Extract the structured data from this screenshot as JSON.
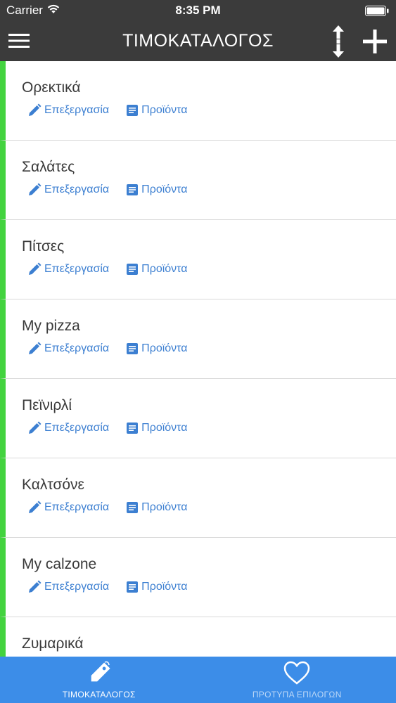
{
  "status_bar": {
    "carrier": "Carrier",
    "time": "8:35 PM"
  },
  "nav": {
    "title": "ΤΙΜΟΚΑΤΑΛΟΓΟΣ",
    "icons": [
      "menu-icon",
      "sort-icon",
      "plus-icon"
    ]
  },
  "colors": {
    "header": "#3b3b3b",
    "accent_bar": "#43d33f",
    "link": "#3c7fd1",
    "tab_bar": "#3c8de8"
  },
  "list": {
    "items": [
      {
        "name": "Ορεκτικά",
        "edit_label": "Επεξεργασία",
        "products_label": "Προϊόντα"
      },
      {
        "name": "Σαλάτες",
        "edit_label": "Επεξεργασία",
        "products_label": "Προϊόντα"
      },
      {
        "name": "Πίτσες",
        "edit_label": "Επεξεργασία",
        "products_label": "Προϊόντα"
      },
      {
        "name": "My pizza",
        "edit_label": "Επεξεργασία",
        "products_label": "Προϊόντα"
      },
      {
        "name": "Πεϊνιρλί",
        "edit_label": "Επεξεργασία",
        "products_label": "Προϊόντα"
      },
      {
        "name": "Καλτσόνε",
        "edit_label": "Επεξεργασία",
        "products_label": "Προϊόντα"
      },
      {
        "name": "My calzone",
        "edit_label": "Επεξεργασία",
        "products_label": "Προϊόντα"
      },
      {
        "name": "Ζυμαρικά",
        "edit_label": "Επεξεργασία",
        "products_label": "Προϊόντα"
      }
    ]
  },
  "tabs": [
    {
      "label": "ΤΙΜΟΚΑΤΑΛΟΓΟΣ",
      "icon": "price-tag-icon",
      "active": true
    },
    {
      "label": "ΠΡΟΤΥΠΑ ΕΠΙΛΟΓΩΝ",
      "icon": "heart-icon",
      "active": false
    }
  ]
}
